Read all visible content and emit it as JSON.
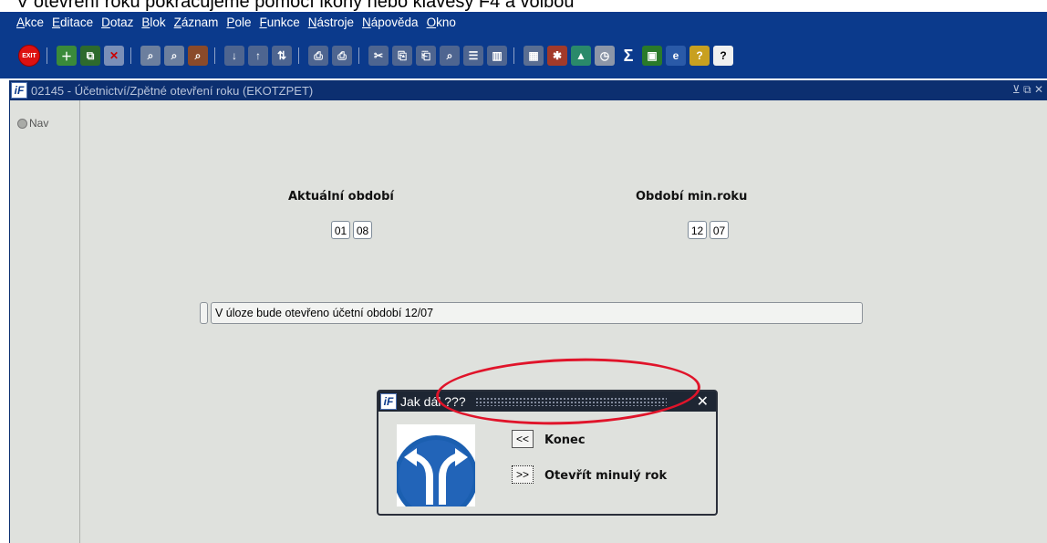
{
  "caption": "V otevření roku pokračujeme pomocí ikony nebo klávesy F4 a volbou",
  "menu": [
    "Akce",
    "Editace",
    "Dotaz",
    "Blok",
    "Záznam",
    "Pole",
    "Funkce",
    "Nástroje",
    "Nápověda",
    "Okno"
  ],
  "toolbar": {
    "exit_label": "EXIT",
    "sum_label": "Σ",
    "help_label": "?"
  },
  "window": {
    "title": "02145 - Účetnictví/Zpětné otevření roku (EKOTZPET)",
    "logo": "iF"
  },
  "nav": {
    "label": "Nav"
  },
  "current_period": {
    "label": "Aktuální období",
    "month": "01",
    "year": "08"
  },
  "min_period": {
    "label": "Období min.roku",
    "month": "12",
    "year": "07"
  },
  "message": "V úloze bude otevřeno účetní období 12/07",
  "dialog": {
    "title": "Jak dál ???",
    "close": "✕",
    "back_btn": "<<",
    "back_label": "Konec",
    "fwd_btn": ">>",
    "fwd_label": "Otevřít minulý rok"
  },
  "colors": {
    "menubar": "#0b3a8c",
    "titlebar": "#0c2f70",
    "form_bg": "#dfe1dd",
    "highlight": "#e0142a"
  }
}
